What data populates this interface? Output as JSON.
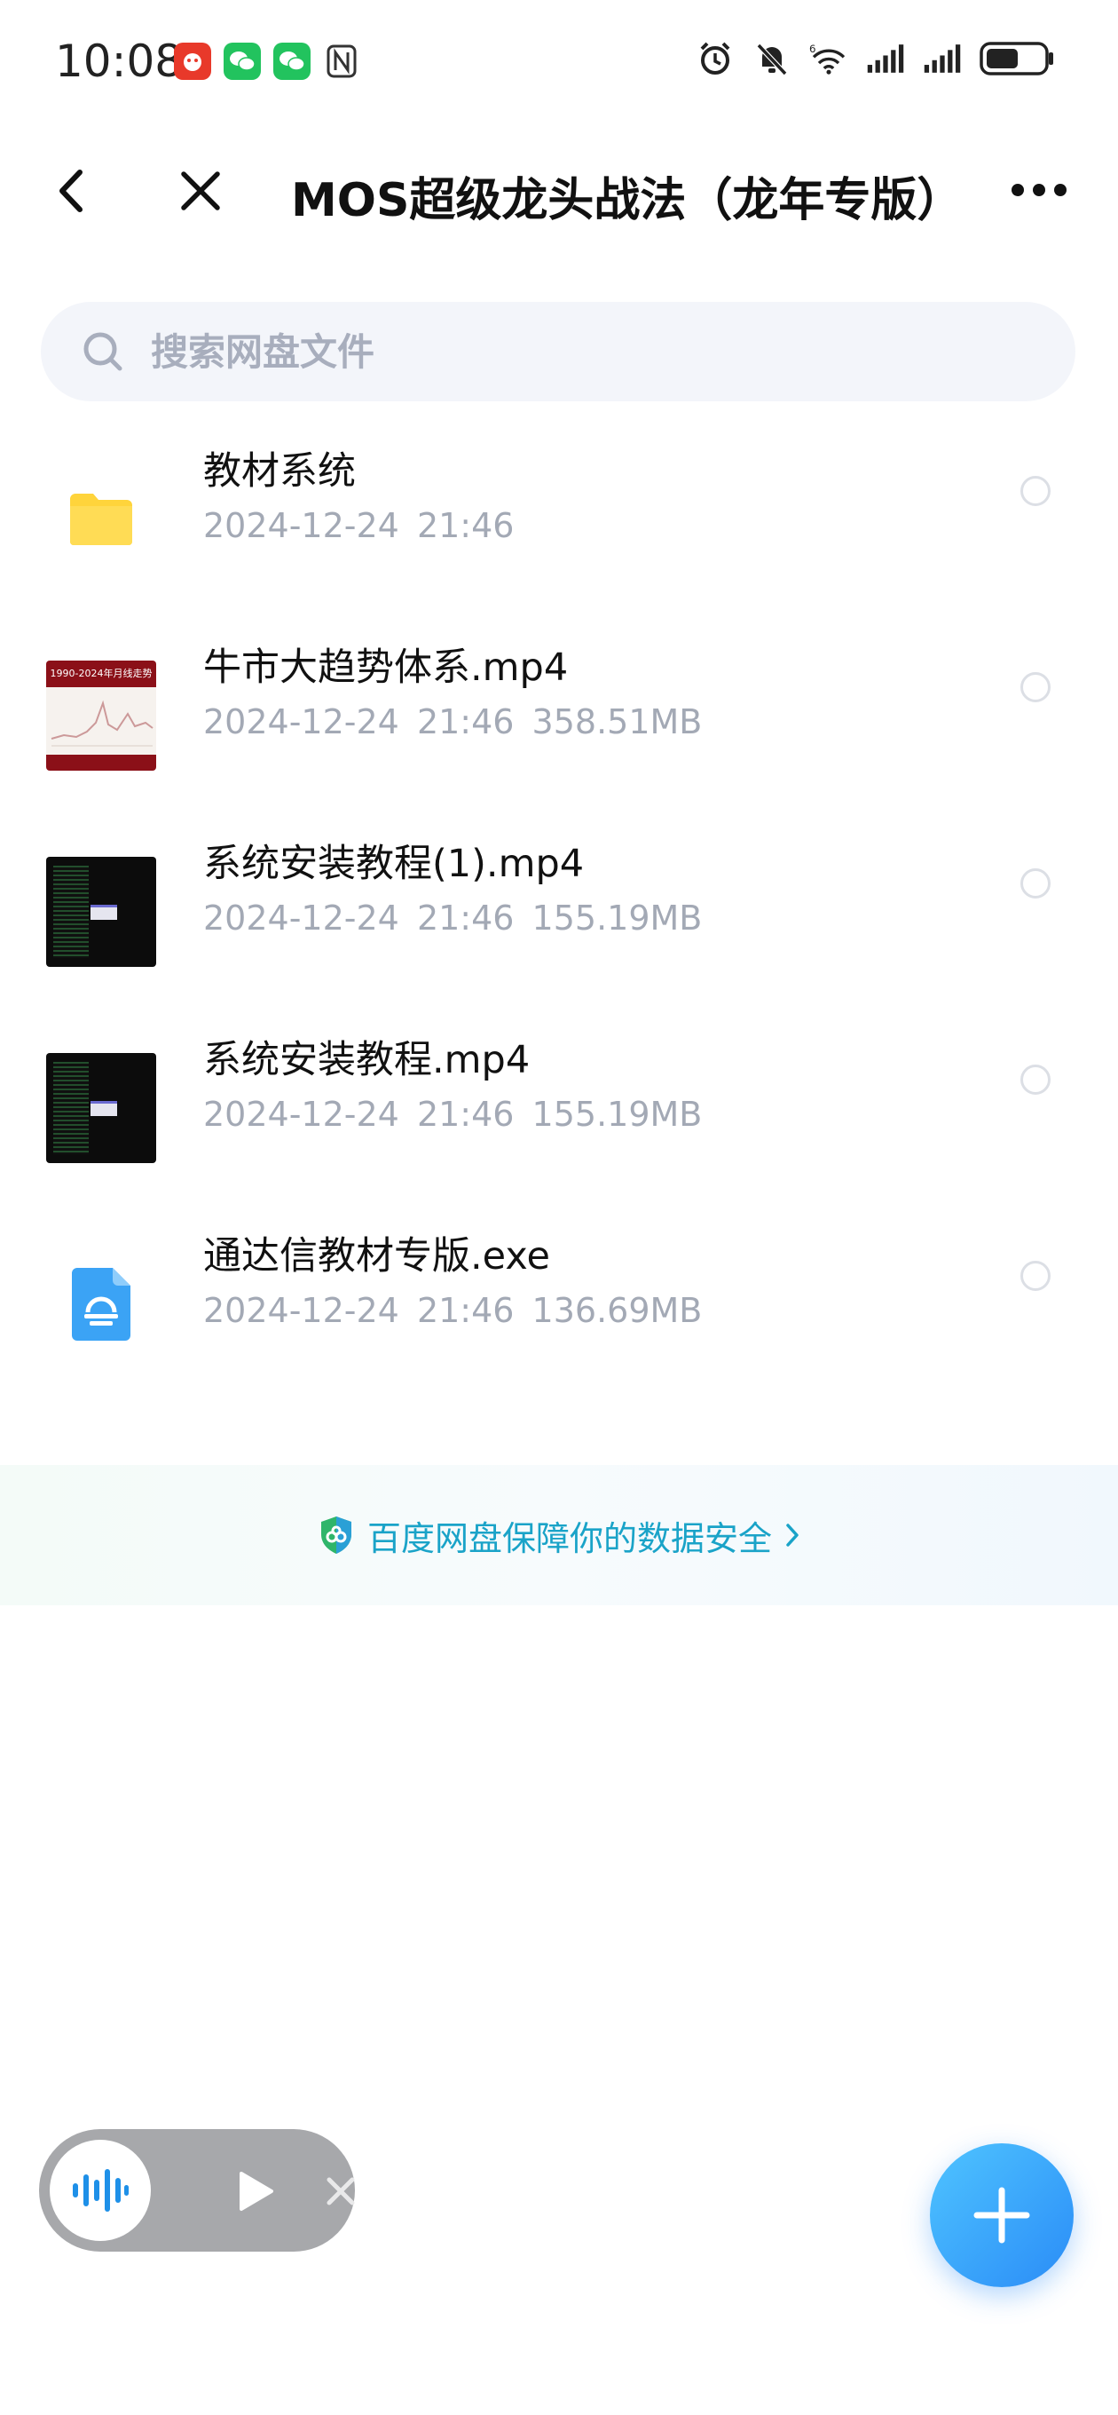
{
  "status_bar": {
    "time": "10:08",
    "battery_level_percent": 55,
    "signal_label": "6"
  },
  "header": {
    "title": "MOS超级龙头战法（龙年专版）"
  },
  "search": {
    "placeholder": "搜索网盘文件",
    "value": ""
  },
  "files": [
    {
      "name": "教材系统",
      "date": "2024-12-24",
      "time": "21:46",
      "size": "",
      "type": "folder"
    },
    {
      "name": "牛市大趋势体系.mp4",
      "date": "2024-12-24",
      "time": "21:46",
      "size": "358.51MB",
      "type": "video",
      "thumb_text": "1990-2024年月线走势"
    },
    {
      "name": "系统安装教程(1).mp4",
      "date": "2024-12-24",
      "time": "21:46",
      "size": "155.19MB",
      "type": "video"
    },
    {
      "name": "系统安装教程.mp4",
      "date": "2024-12-24",
      "time": "21:46",
      "size": "155.19MB",
      "type": "video"
    },
    {
      "name": "通达信教材专版.exe",
      "date": "2024-12-24",
      "time": "21:46",
      "size": "136.69MB",
      "type": "app"
    }
  ],
  "safety_banner": {
    "text": "百度网盘保障你的数据安全"
  },
  "icons": {
    "back": "chevron-left-icon",
    "close": "close-icon",
    "more": "more-horizontal-icon",
    "search": "search-icon",
    "folder": "folder-icon",
    "app_file": "app-file-icon",
    "shield": "shield-icon",
    "wave": "audio-wave-icon",
    "play": "play-icon",
    "plus": "plus-icon"
  },
  "colors": {
    "accent": "#2a8cf7",
    "folder": "#ffd43b",
    "safety_text": "#1aa3c8",
    "meta_text": "#a3a9b5"
  }
}
